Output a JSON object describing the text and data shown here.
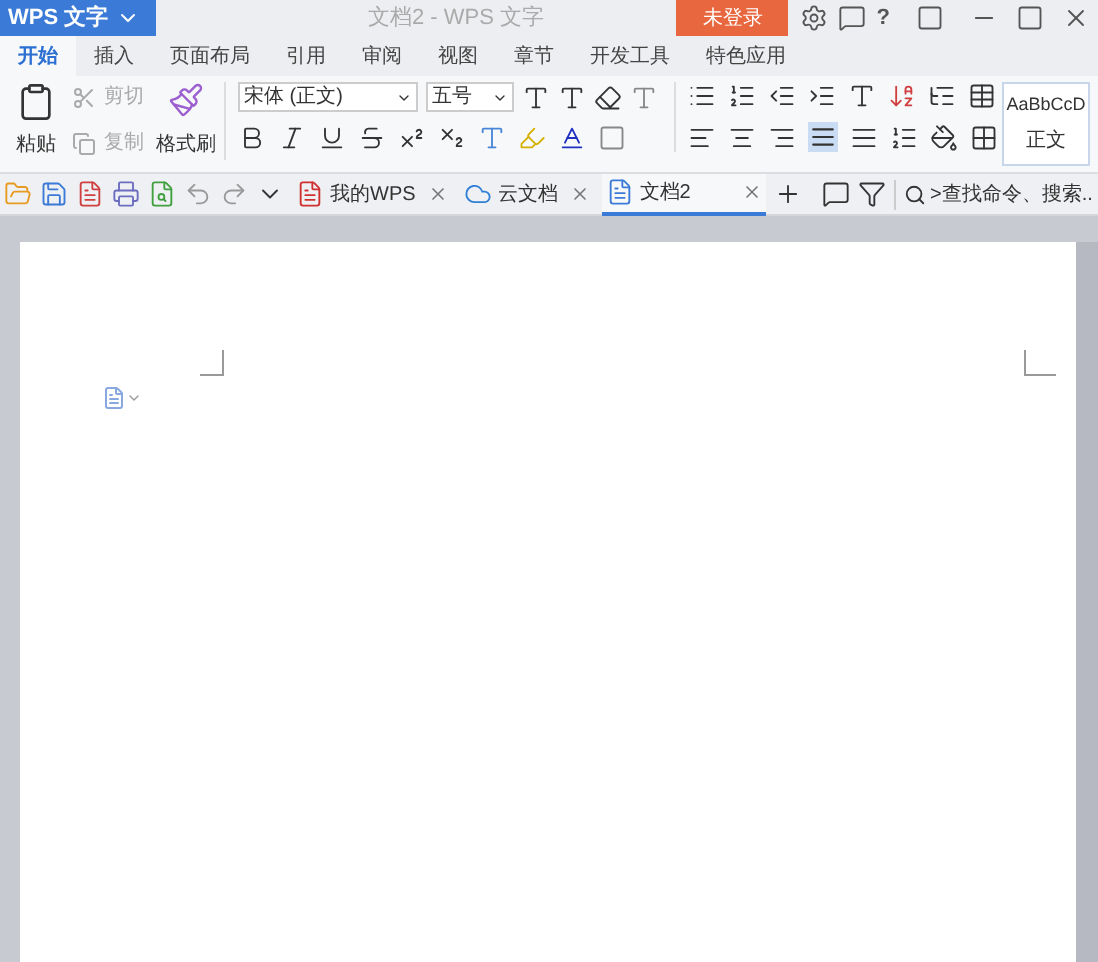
{
  "window": {
    "app_menu": "WPS 文字",
    "title": "文档2 - WPS 文字",
    "login": "未登录",
    "help": "?"
  },
  "tabs": [
    {
      "label": "开始",
      "selected": true
    },
    {
      "label": "插入",
      "selected": false
    },
    {
      "label": "页面布局",
      "selected": false
    },
    {
      "label": "引用",
      "selected": false
    },
    {
      "label": "审阅",
      "selected": false
    },
    {
      "label": "视图",
      "selected": false
    },
    {
      "label": "章节",
      "selected": false
    },
    {
      "label": "开发工具",
      "selected": false
    },
    {
      "label": "特色应用",
      "selected": false
    }
  ],
  "ribbon": {
    "paste": "粘贴",
    "cut": {
      "label": "剪切",
      "disabled": true
    },
    "copy": {
      "label": "复制",
      "disabled": true
    },
    "format_painter": "格式刷",
    "font": "宋体 (正文)",
    "font_size": "五号",
    "style_preview": "AaBbCcD",
    "style_name": "正文",
    "align_justify_selected": true
  },
  "doc_tabs": [
    {
      "label": "我的WPS",
      "kind": "home",
      "selected": false
    },
    {
      "label": "云文档",
      "kind": "cloud",
      "selected": false
    },
    {
      "label": "文档2",
      "kind": "doc",
      "selected": true
    }
  ],
  "search": {
    "placeholder": ">查找命令、搜索..."
  }
}
